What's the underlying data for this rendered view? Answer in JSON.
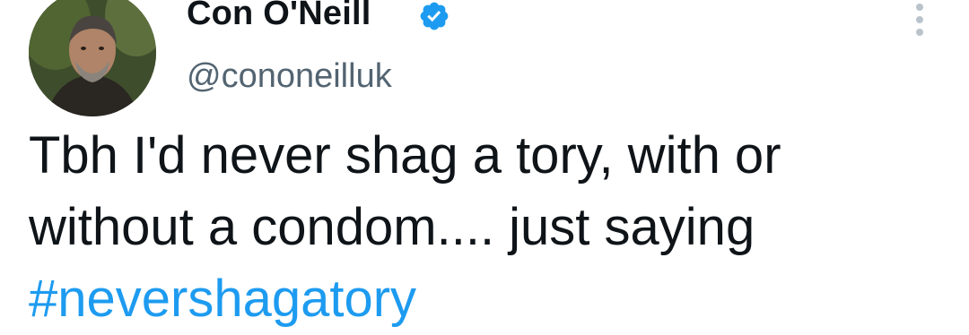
{
  "tweet": {
    "author": {
      "display_name": "Con O'Neill",
      "handle": "@cononeilluk",
      "verified": true,
      "avatar_icon": "profile-photo"
    },
    "text_lines": [
      "Tbh I'd never shag a tory, with or",
      "without a condom.... just saying"
    ],
    "hashtag": "#nevershagatory",
    "menu_icon": "more-options-icon"
  },
  "colors": {
    "text": "#0f1419",
    "secondary_text": "#536471",
    "link": "#1d9bf0",
    "verified_badge": "#1d9bf0"
  }
}
